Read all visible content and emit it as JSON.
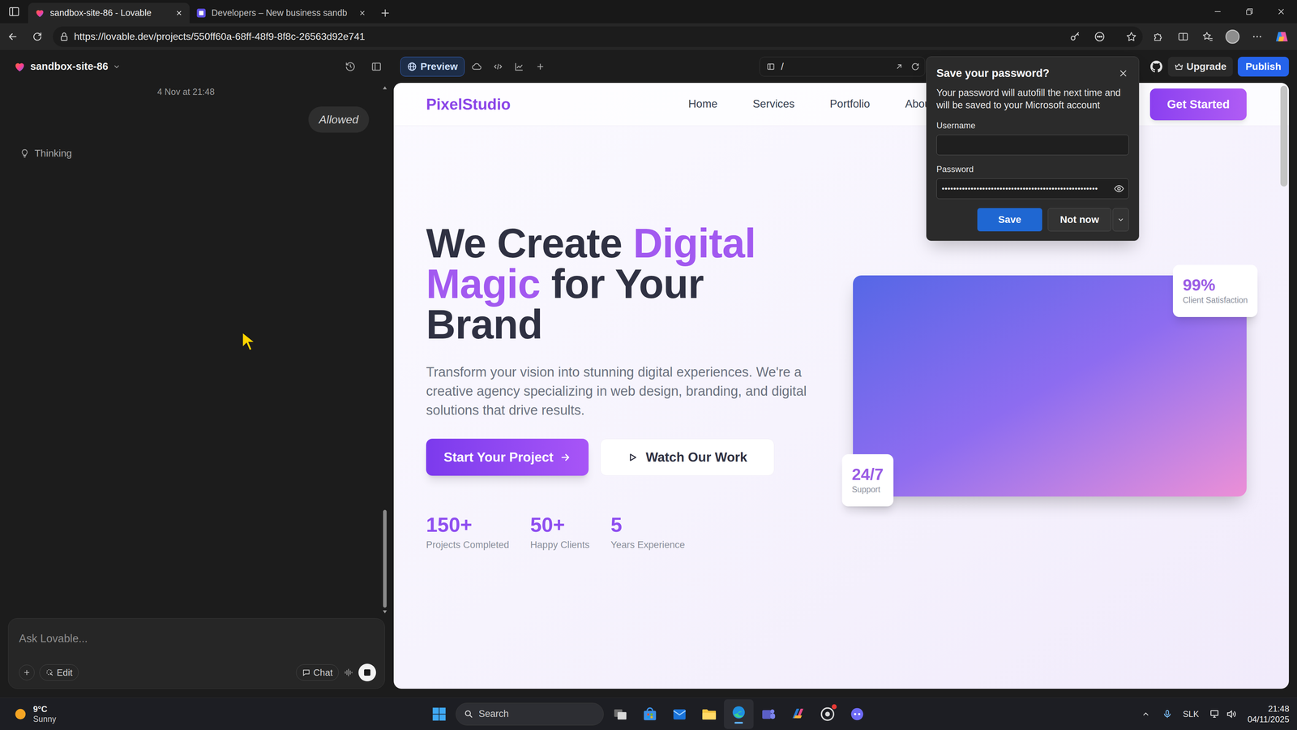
{
  "browser": {
    "tabs": [
      {
        "label": "sandbox-site-86 - Lovable",
        "selected": true
      },
      {
        "label": "Developers – New business sandb",
        "selected": false
      }
    ],
    "url": "https://lovable.dev/projects/550ff60a-68ff-48f9-8f8c-26563d92e741"
  },
  "app": {
    "project": "sandbox-site-86",
    "chat": {
      "date": "4 Nov at 21:48",
      "messages": [
        "Allowed"
      ],
      "status": "Thinking",
      "placeholder": "Ask Lovable...",
      "edit": "Edit",
      "mode": "Chat"
    },
    "toolbar": {
      "preview": {
        "label": "Preview",
        "selected": true
      },
      "path": "/",
      "upgrade": "Upgrade",
      "publish": "Publish"
    }
  },
  "site": {
    "brand": "PixelStudio",
    "nav": [
      "Home",
      "Services",
      "Portfolio",
      "Abou"
    ],
    "cta": "Get Started",
    "heading": [
      [
        {
          "text": "We Create ",
          "accent": false
        },
        {
          "text": "Digital",
          "accent": true
        }
      ],
      [
        {
          "text": "Magic",
          "accent": true
        },
        {
          "text": " for Your",
          "accent": false
        }
      ],
      [
        {
          "text": "Brand",
          "accent": false
        }
      ]
    ],
    "intro": "Transform your vision into stunning digital experiences. We're a creative agency specializing in web design, branding, and digital solutions that drive results.",
    "buttons": {
      "primary": "Start Your Project",
      "secondary": "Watch Our Work"
    },
    "stats": [
      {
        "value": "150+",
        "label": "Projects Completed"
      },
      {
        "value": "50+",
        "label": "Happy Clients"
      },
      {
        "value": "5",
        "label": "Years Experience"
      }
    ],
    "badges": {
      "satisfaction": {
        "value": "99%",
        "label": "Client Satisfaction"
      },
      "support": {
        "value": "24/7",
        "label": "Support"
      }
    }
  },
  "password_dialog": {
    "title": "Save your password?",
    "message": "Your password will autofill the next time and will be saved to your Microsoft account",
    "username_label": "Username",
    "password_label": "Password",
    "password": "••••••••••••••••••••••••••••••••••••••••••••••••••••••",
    "save": "Save",
    "dismiss": "Not now"
  },
  "taskbar": {
    "weather": {
      "temp": "9°C",
      "condition": "Sunny"
    },
    "search": "Search",
    "language": "SLK",
    "time": "21:48",
    "date": "04/11/2025"
  }
}
